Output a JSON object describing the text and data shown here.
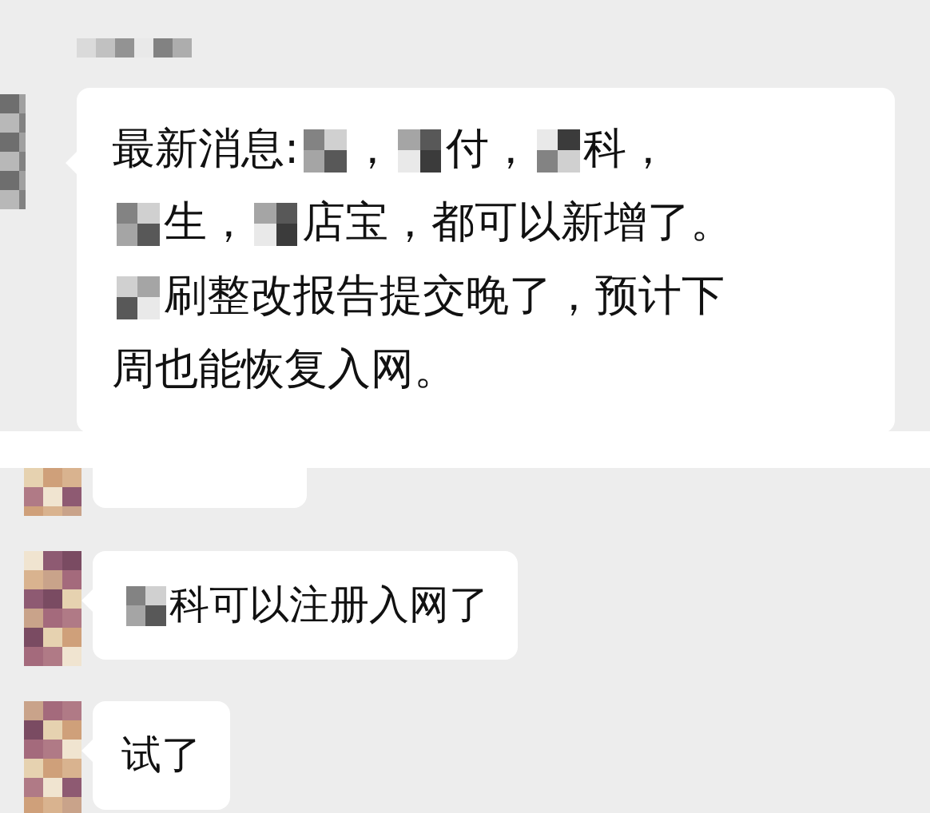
{
  "screens": [
    {
      "messages": [
        {
          "kind": "text",
          "lines": [
            [
              {
                "kind": "text",
                "text": "最新消息: "
              },
              {
                "kind": "mosaic"
              },
              {
                "kind": "text",
                "text": "，"
              },
              {
                "kind": "mosaic"
              },
              {
                "kind": "text",
                "text": "付，"
              },
              {
                "kind": "mosaic"
              },
              {
                "kind": "text",
                "text": "科，"
              }
            ],
            [
              {
                "kind": "mosaic"
              },
              {
                "kind": "text",
                "text": "生，"
              },
              {
                "kind": "mosaic"
              },
              {
                "kind": "text",
                "text": "店宝，都可以新增了。"
              }
            ],
            [
              {
                "kind": "mosaic"
              },
              {
                "kind": "text",
                "text": "刷整改报告提交晚了，预计下"
              }
            ],
            [
              {
                "kind": "text",
                "text": "周也能恢复入网。"
              }
            ]
          ]
        }
      ]
    },
    {
      "messages": [
        {
          "kind": "cut"
        },
        {
          "kind": "text",
          "lines": [
            [
              {
                "kind": "mosaic"
              },
              {
                "kind": "text",
                "text": "科可以注册入网了"
              }
            ]
          ]
        },
        {
          "kind": "text",
          "lines": [
            [
              {
                "kind": "text",
                "text": "试了"
              }
            ]
          ]
        }
      ]
    }
  ]
}
